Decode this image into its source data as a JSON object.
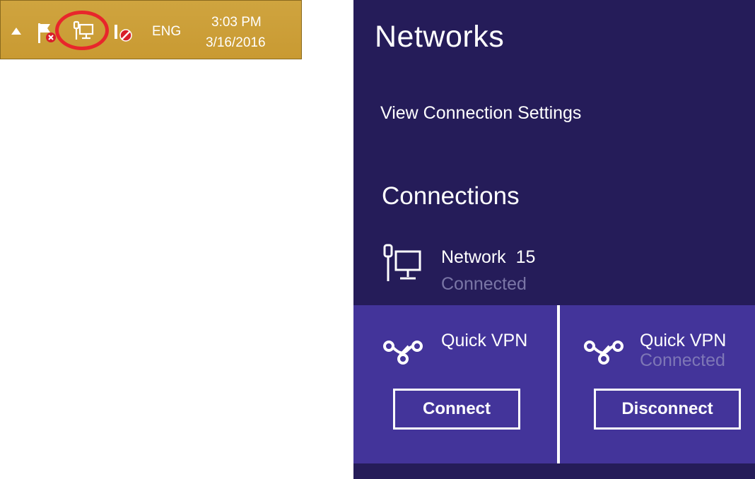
{
  "taskbar": {
    "language": "ENG",
    "time": "3:03 PM",
    "date": "3/16/2016",
    "icons": [
      "show-hidden-icons-arrow",
      "action-center-flag-icon",
      "network-wired-icon",
      "volume-muted-icon"
    ],
    "highlight_color": "#e8262b",
    "background_color": "#cfa43f"
  },
  "flyout": {
    "title": "Networks",
    "view_settings_link": "View Connection Settings",
    "connections_heading": "Connections",
    "background_color": "#251c59",
    "network": {
      "name": "Network  15",
      "status": "Connected",
      "icon": "wired-network-icon"
    },
    "vpn_area_color": "#43349a",
    "vpn_tiles": [
      {
        "name": "Quick VPN",
        "status": "",
        "button": "Connect",
        "icon": "vpn-icon"
      },
      {
        "name": "Quick VPN",
        "status": "Connected",
        "button": "Disconnect",
        "icon": "vpn-icon"
      }
    ]
  }
}
